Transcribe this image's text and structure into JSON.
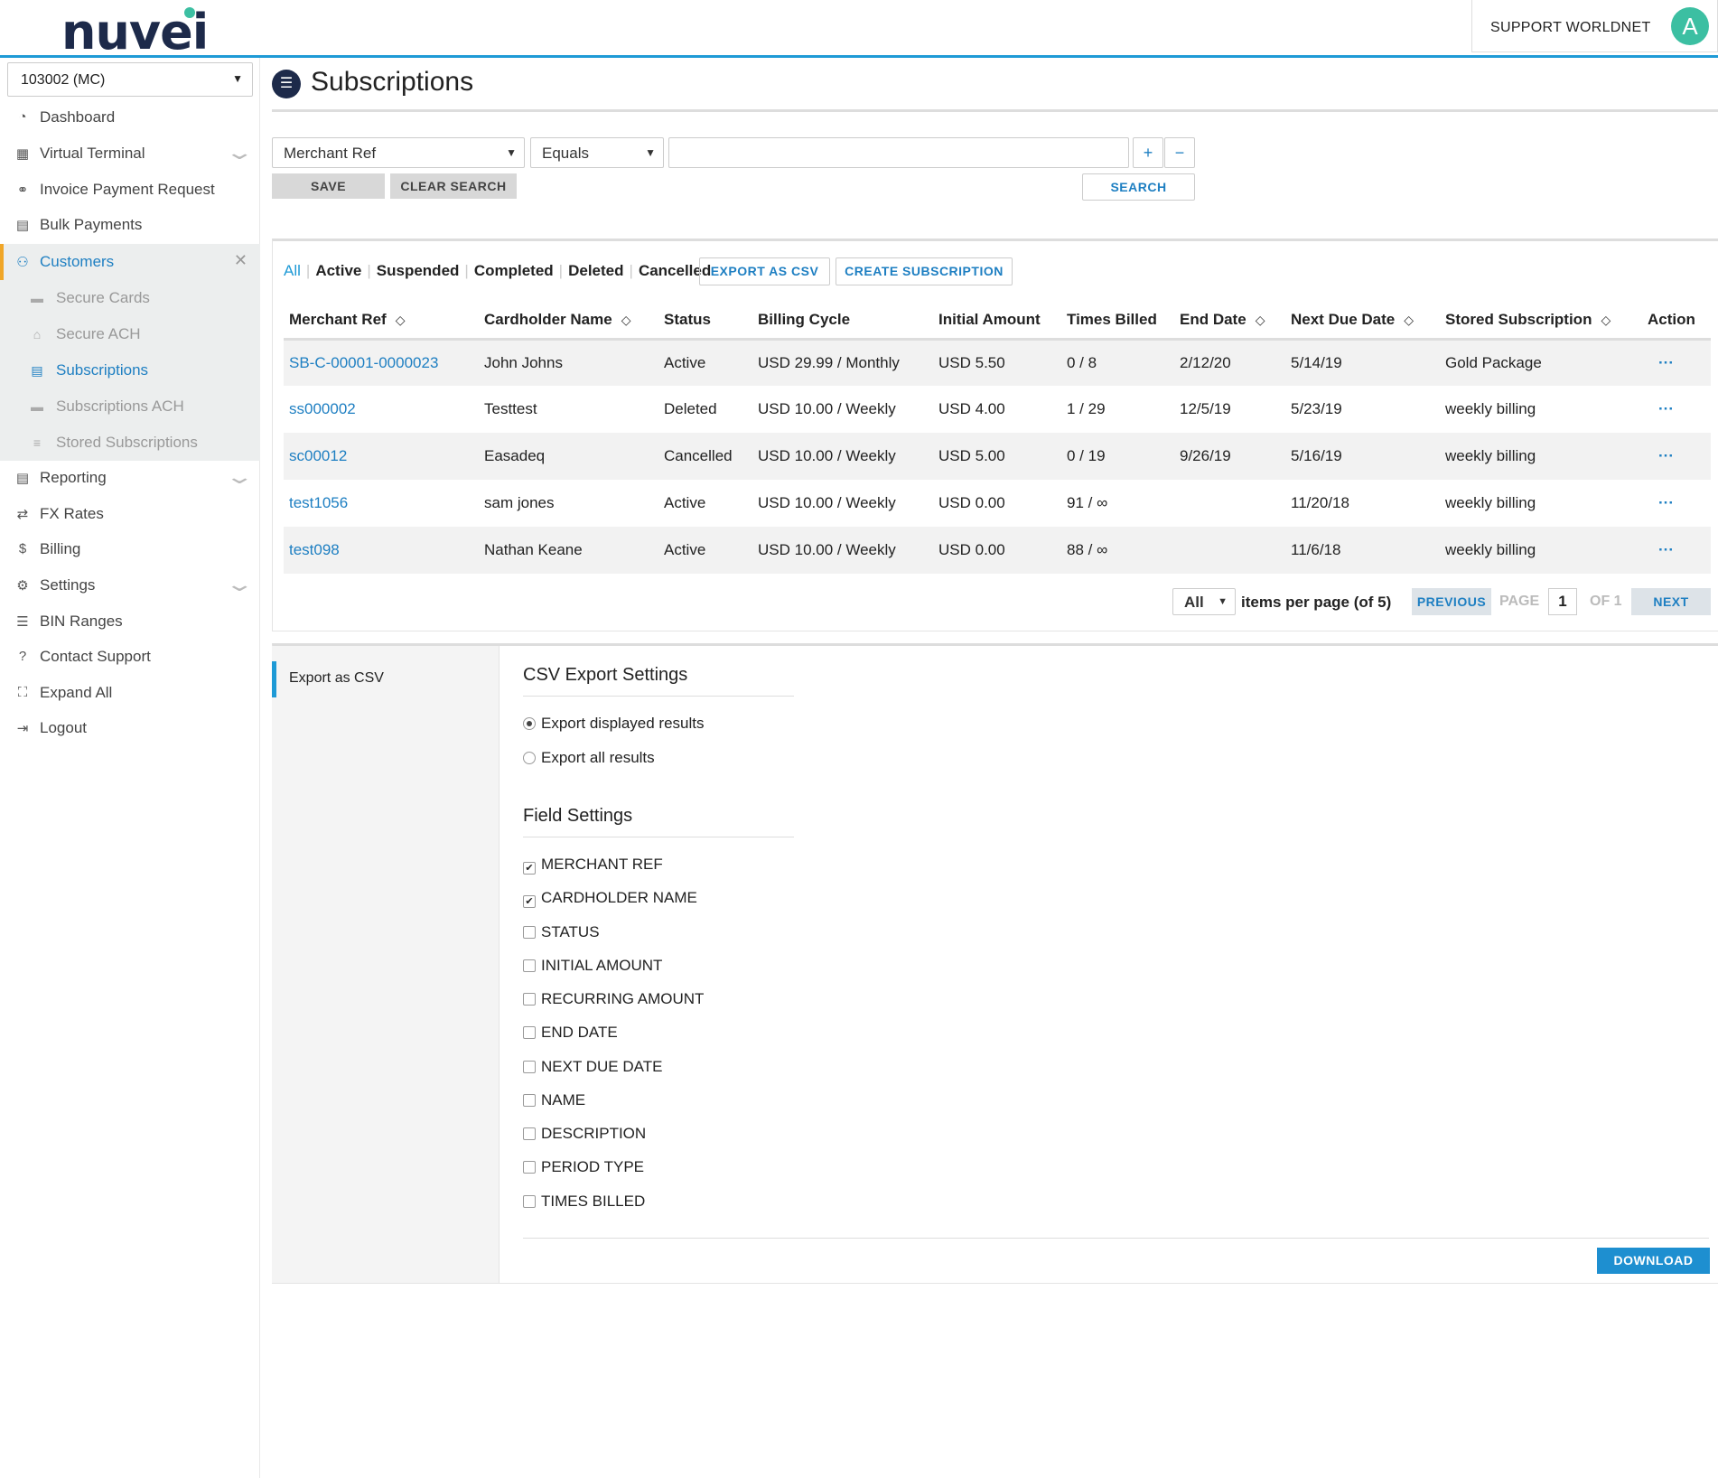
{
  "header": {
    "logo_text": "nuvei",
    "account_name": "SUPPORT WORLDNET",
    "avatar_initial": "A"
  },
  "sidebar": {
    "merchant_select": "103002 (MC)",
    "items": [
      {
        "label": "Dashboard",
        "icon": "dashboard-icon"
      },
      {
        "label": "Virtual Terminal",
        "icon": "calculator-icon"
      },
      {
        "label": "Invoice Payment Request",
        "icon": "link-icon"
      },
      {
        "label": "Bulk Payments",
        "icon": "file-icon"
      },
      {
        "label": "Customers",
        "icon": "users-icon"
      },
      {
        "label": "Reporting",
        "icon": "report-icon"
      },
      {
        "label": "FX Rates",
        "icon": "exchange-icon"
      },
      {
        "label": "Billing",
        "icon": "billing-icon"
      },
      {
        "label": "Settings",
        "icon": "gears-icon"
      },
      {
        "label": "BIN Ranges",
        "icon": "list-icon"
      },
      {
        "label": "Contact Support",
        "icon": "help-icon"
      },
      {
        "label": "Expand All",
        "icon": "expand-icon"
      },
      {
        "label": "Logout",
        "icon": "logout-icon"
      }
    ],
    "customer_sub": [
      {
        "label": "Secure Cards",
        "icon": "card-icon"
      },
      {
        "label": "Secure ACH",
        "icon": "bank-icon"
      },
      {
        "label": "Subscriptions",
        "icon": "subscription-icon"
      },
      {
        "label": "Subscriptions ACH",
        "icon": "card-icon"
      },
      {
        "label": "Stored Subscriptions",
        "icon": "database-icon"
      }
    ]
  },
  "page": {
    "title": "Subscriptions"
  },
  "search": {
    "field_select": "Merchant Ref",
    "operator_select": "Equals",
    "input_value": "",
    "add_label": "+",
    "remove_label": "−",
    "save_label": "SAVE",
    "clear_label": "CLEAR SEARCH",
    "search_label": "SEARCH"
  },
  "filters": {
    "all": "All",
    "active": "Active",
    "suspended": "Suspended",
    "completed": "Completed",
    "deleted": "Deleted",
    "cancelled": "Cancelled"
  },
  "actions": {
    "export_csv": "EXPORT AS CSV",
    "create_subscription": "CREATE SUBSCRIPTION"
  },
  "table": {
    "columns": [
      "Merchant Ref",
      "Cardholder Name",
      "Status",
      "Billing Cycle",
      "Initial Amount",
      "Times Billed",
      "End Date",
      "Next Due Date",
      "Stored Subscription",
      "Action"
    ],
    "rows": [
      [
        "SB-C-00001-0000023",
        "John Johns",
        "Active",
        "USD 29.99 / Monthly",
        "USD 5.50",
        "0 / 8",
        "2/12/20",
        "5/14/19",
        "Gold Package",
        "···"
      ],
      [
        "ss000002",
        "Testtest",
        "Deleted",
        "USD 10.00 / Weekly",
        "USD 4.00",
        "1 / 29",
        "12/5/19",
        "5/23/19",
        "weekly billing",
        "···"
      ],
      [
        "sc00012",
        "Easadeq",
        "Cancelled",
        "USD 10.00 / Weekly",
        "USD 5.00",
        "0 / 19",
        "9/26/19",
        "5/16/19",
        "weekly billing",
        "···"
      ],
      [
        "test1056",
        "sam jones",
        "Active",
        "USD 10.00 / Weekly",
        "USD 0.00",
        "91 / ∞",
        "",
        "11/20/18",
        "weekly billing",
        "···"
      ],
      [
        "test098",
        "Nathan Keane",
        "Active",
        "USD 10.00 / Weekly",
        "USD 0.00",
        "88 / ∞",
        "",
        "11/6/18",
        "weekly billing",
        "···"
      ]
    ]
  },
  "pagination": {
    "per_page": "All",
    "per_page_label": "items per page (of 5)",
    "previous": "PREVIOUS",
    "page_label": "PAGE",
    "page_value": "1",
    "of_label": "OF 1",
    "next": "NEXT"
  },
  "export": {
    "tab_label": "Export as CSV",
    "settings_title": "CSV Export Settings",
    "option_displayed": "Export displayed results",
    "option_all": "Export all results",
    "selected_option": "displayed",
    "field_settings_title": "Field Settings",
    "fields": [
      {
        "label": "MERCHANT REF",
        "checked": true
      },
      {
        "label": "CARDHOLDER NAME",
        "checked": true
      },
      {
        "label": "STATUS",
        "checked": false
      },
      {
        "label": "INITIAL AMOUNT",
        "checked": false
      },
      {
        "label": "RECURRING AMOUNT",
        "checked": false
      },
      {
        "label": "END DATE",
        "checked": false
      },
      {
        "label": "NEXT DUE DATE",
        "checked": false
      },
      {
        "label": "NAME",
        "checked": false
      },
      {
        "label": "DESCRIPTION",
        "checked": false
      },
      {
        "label": "PERIOD TYPE",
        "checked": false
      },
      {
        "label": "TIMES BILLED",
        "checked": false
      }
    ],
    "download_label": "DOWNLOAD"
  },
  "colors": {
    "brand_navy": "#1d2a4a",
    "brand_teal": "#3cbfa2",
    "link_blue": "#1e7fc2",
    "accent_orange": "#f0a628"
  }
}
